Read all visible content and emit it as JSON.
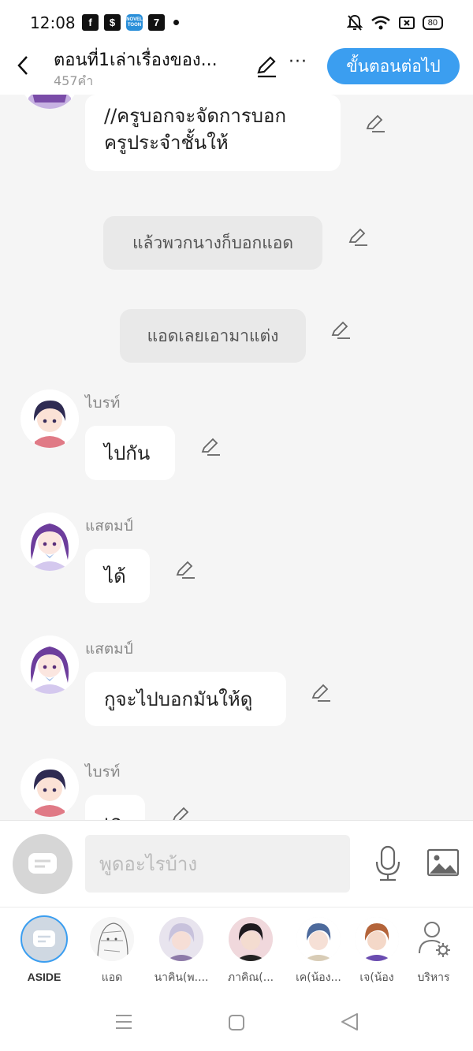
{
  "status_bar": {
    "time": "12:08",
    "app_icons": [
      "facebook-icon",
      "dollar-shield-icon",
      "novel-toon-icon",
      "seven-eleven-icon"
    ],
    "battery": "80"
  },
  "header": {
    "title": "ตอนที่1เล่าเรื่องของ...",
    "word_count": "457คำ",
    "next_button": "ขั้นตอนต่อไป",
    "more_label": "···"
  },
  "chat": {
    "messages": [
      {
        "type": "bubble",
        "text_line1": "//ครูบอกจะจัดการบอก",
        "text_line2": "ครูประจำชั้นให้"
      },
      {
        "type": "narration",
        "text": "แล้วพวกนางก็บอกแอด"
      },
      {
        "type": "narration",
        "text": "แอดเลยเอามาแต่ง"
      },
      {
        "type": "bubble",
        "speaker": "ไบรท์",
        "text": "ไปกัน"
      },
      {
        "type": "bubble",
        "speaker": "แสตมป์",
        "text": "ได้"
      },
      {
        "type": "bubble",
        "speaker": "แสตมป์",
        "text": "กูจะไปบอกมันให้ดู"
      },
      {
        "type": "bubble",
        "speaker": "ไบรท์",
        "text": "เอ"
      }
    ]
  },
  "input": {
    "placeholder": "พูดอะไรบ้าง"
  },
  "characters": [
    {
      "label": "ASIDE"
    },
    {
      "label": "แอด"
    },
    {
      "label": "นาคิน(พ...."
    },
    {
      "label": "ภาคิณ(..."
    },
    {
      "label": "เค(น้อง..."
    },
    {
      "label": "เจ(น้อง"
    },
    {
      "label": "บริหาร"
    }
  ],
  "colors": {
    "accent": "#3b9ef0",
    "background": "#f5f5f5",
    "bubble": "#ffffff",
    "narration": "#e9e9e9"
  }
}
